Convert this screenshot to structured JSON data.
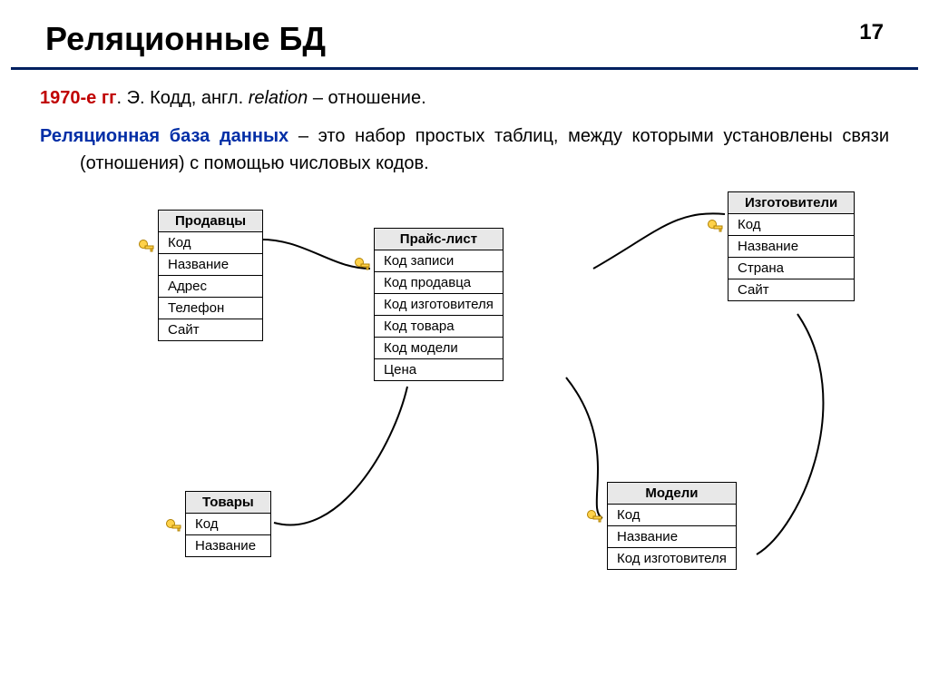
{
  "header": {
    "title": "Реляционные БД",
    "page_number": "17"
  },
  "intro": {
    "year": "1970-е гг",
    "rest1": ". Э. Кодд, англ. ",
    "relation": "relation",
    "rest2": " – отношение."
  },
  "definition": {
    "term": "Реляционная база данных",
    "body": " – это набор простых таблиц, между которыми установлены связи (отношения) с помощью числовых кодов."
  },
  "entities": {
    "sellers": {
      "title": "Продавцы",
      "fields": [
        "Код",
        "Название",
        "Адрес",
        "Телефон",
        "Сайт"
      ]
    },
    "price": {
      "title": "Прайс-лист",
      "fields": [
        "Код записи",
        "Код продавца",
        "Код изготовителя",
        "Код товара",
        "Код модели",
        "Цена"
      ]
    },
    "makers": {
      "title": "Изготовители",
      "fields": [
        "Код",
        "Название",
        "Страна",
        "Сайт"
      ]
    },
    "goods": {
      "title": "Товары",
      "fields": [
        "Код",
        "Название"
      ]
    },
    "models": {
      "title": "Модели",
      "fields": [
        "Код",
        "Название",
        "Код изготовителя"
      ]
    }
  }
}
